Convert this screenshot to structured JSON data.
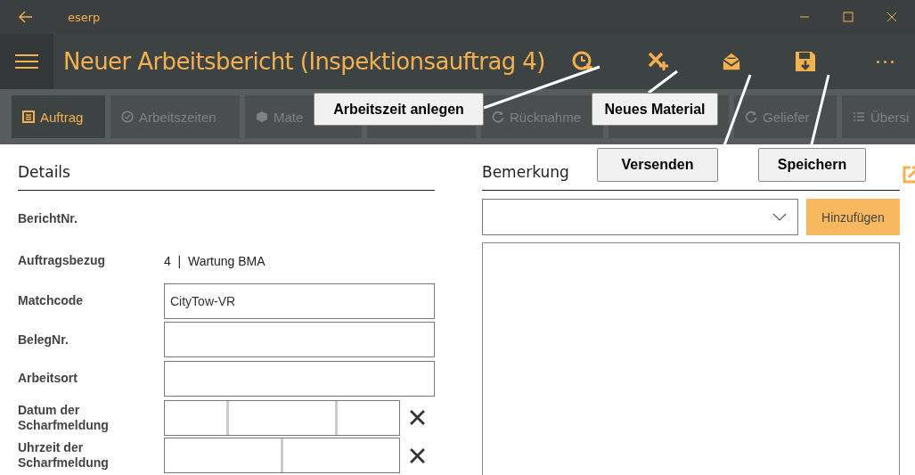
{
  "window": {
    "title": "eserp"
  },
  "app_bar": {
    "title": "Neuer Arbeitsbericht (Inspektionsauftrag 4)"
  },
  "tabs": [
    {
      "label": "Auftrag",
      "selected": true,
      "kind": "list"
    },
    {
      "label": "Arbeitszeiten",
      "selected": false,
      "kind": "clock"
    },
    {
      "label": "Mate",
      "selected": false,
      "kind": "box"
    },
    {
      "selected": false,
      "kind": "none"
    },
    {
      "label": "Rücknahme",
      "selected": false,
      "kind": "refresh"
    },
    {
      "selected": false,
      "kind": "none"
    },
    {
      "label": "Geliefer",
      "selected": false,
      "kind": "refresh"
    },
    {
      "label": "Übersi",
      "selected": false,
      "kind": "lines"
    }
  ],
  "callouts": [
    {
      "text": "Arbeitszeit anlegen"
    },
    {
      "text": "Neues Material"
    },
    {
      "text": "Versenden"
    },
    {
      "text": "Speichern"
    }
  ],
  "details": {
    "heading": "Details",
    "fields": [
      {
        "label": "BerichtNr.",
        "kind": "static"
      },
      {
        "label": "Auftragsbezug",
        "kind": "static",
        "value": "4  |  Wartung BMA"
      },
      {
        "label": "Matchcode",
        "kind": "text",
        "value": "CityTow-VR"
      },
      {
        "label": "BelegNr.",
        "kind": "text"
      },
      {
        "label": "Arbeitsort",
        "kind": "text"
      },
      {
        "label": "Datum der Scharfmeldung",
        "kind": "date"
      },
      {
        "label": "Uhrzeit der Scharfmeldung",
        "kind": "time"
      }
    ]
  },
  "remark": {
    "heading": "Bemerkung",
    "add_button": "Hinzufügen"
  }
}
